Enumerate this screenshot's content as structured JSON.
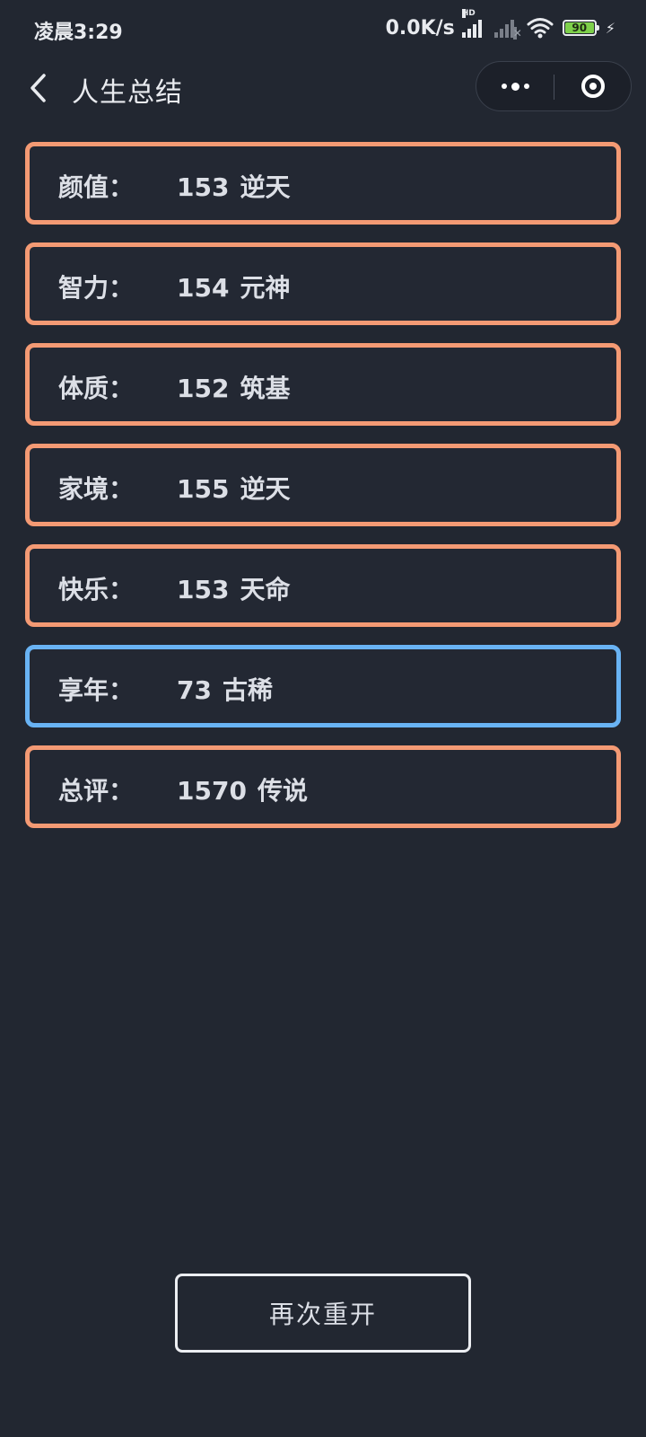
{
  "status_bar": {
    "time": "凌晨3:29",
    "net_speed": "0.0K/s",
    "hd_label": "HD",
    "battery_level": "90",
    "battery_color": "#7ed04b"
  },
  "nav": {
    "title": "人生总结",
    "back_icon": "chevron-left-icon",
    "more_icon": "more-dots-icon",
    "close_icon": "target-circle-icon"
  },
  "summary": {
    "items": [
      {
        "label": "颜值：",
        "value": "153",
        "grade": "逆天",
        "border_color": "#f49a74"
      },
      {
        "label": "智力：",
        "value": "154",
        "grade": "元神",
        "border_color": "#f49a74"
      },
      {
        "label": "体质：",
        "value": "152",
        "grade": "筑基",
        "border_color": "#f49a74"
      },
      {
        "label": "家境：",
        "value": "155",
        "grade": "逆天",
        "border_color": "#f49a74"
      },
      {
        "label": "快乐：",
        "value": "153",
        "grade": "天命",
        "border_color": "#f49a74"
      },
      {
        "label": "享年：",
        "value": "73",
        "grade": "古稀",
        "border_color": "#69b3f4"
      },
      {
        "label": "总评：",
        "value": "1570",
        "grade": "传说",
        "border_color": "#f49a74"
      }
    ]
  },
  "restart": {
    "label": "再次重开"
  }
}
